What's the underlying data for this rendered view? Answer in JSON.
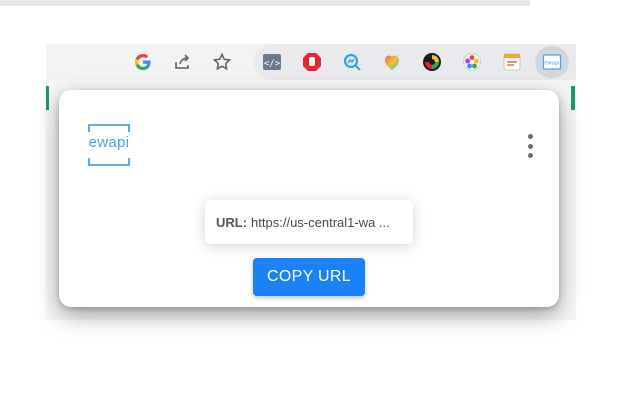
{
  "toolbar": {
    "icons": [
      "google-icon",
      "share-icon",
      "star-bookmark-icon"
    ],
    "extensions": [
      "code-extension-icon",
      "stop-hand-extension-icon",
      "search-magnifier-extension-icon",
      "heart-extension-icon",
      "color-circle-extension-icon",
      "photo-lens-extension-icon",
      "notes-extension-icon",
      "ewapi-extension-icon"
    ]
  },
  "popup": {
    "logo_text": "ewapi",
    "url_label": "URL:",
    "url_value": "https://us-central1-wa ...",
    "copy_button": "COPY URL"
  },
  "colors": {
    "accent": "#1a82f7",
    "logo": "#4aa3e8",
    "green_marker": "#1a9a6b"
  }
}
